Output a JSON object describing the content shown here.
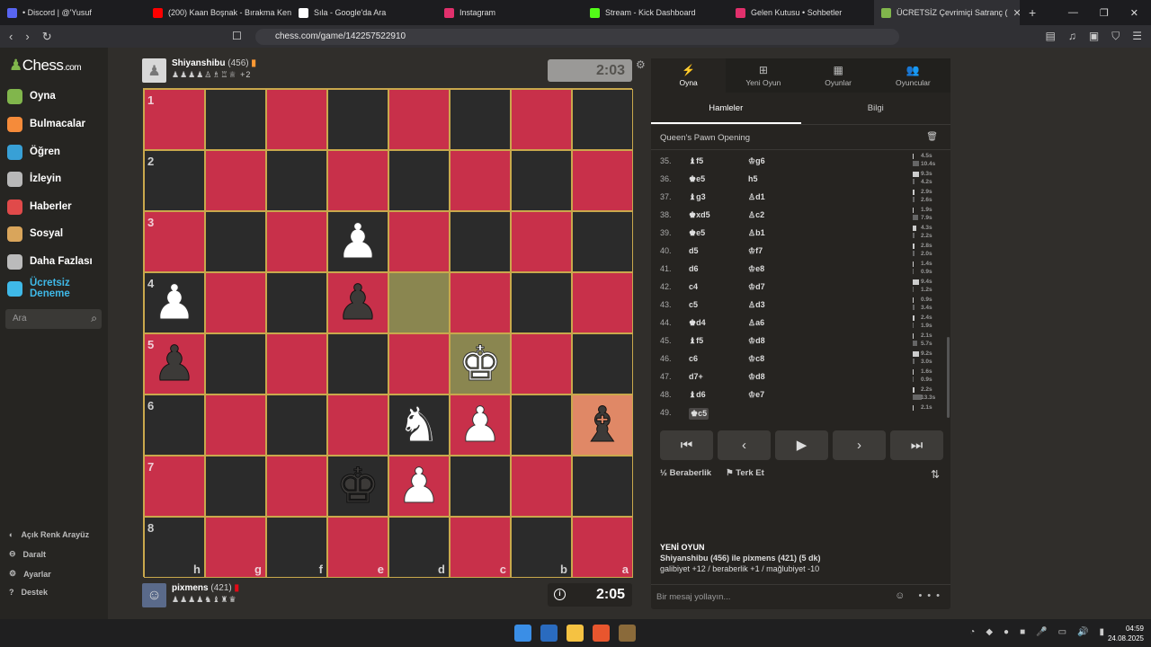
{
  "browser": {
    "tabs": [
      {
        "label": "• Discord | @'Yusuf",
        "color": "#5865f2"
      },
      {
        "label": "(200) Kaan Boşnak - Bırakma Ken",
        "color": "#ff0000"
      },
      {
        "label": "Sıla - Google'da Ara",
        "color": "#ffffff"
      },
      {
        "label": "Instagram",
        "color": "#e1306c"
      },
      {
        "label": "Stream - Kick Dashboard",
        "color": "#53fc18"
      },
      {
        "label": "Gelen Kutusu • Sohbetler",
        "color": "#e1306c"
      },
      {
        "label": "ÜCRETSİZ Çevrimiçi Satranç (",
        "color": "#81b64c"
      }
    ],
    "new_tab": "+",
    "close": "✕",
    "url": "chess.com/game/142257522910"
  },
  "sidebar": {
    "logo": "Chess",
    "logo_suffix": ".com",
    "items": [
      {
        "label": "Oyna",
        "icon": "pawn-icon",
        "color": "#81b64c"
      },
      {
        "label": "Bulmacalar",
        "icon": "puzzle-icon",
        "color": "#f58b3a"
      },
      {
        "label": "Öğren",
        "icon": "learn-icon",
        "color": "#38a0d6"
      },
      {
        "label": "İzleyin",
        "icon": "binoculars-icon",
        "color": "#b8b8b8"
      },
      {
        "label": "Haberler",
        "icon": "news-icon",
        "color": "#e04a4a"
      },
      {
        "label": "Sosyal",
        "icon": "social-icon",
        "color": "#d9a55b"
      },
      {
        "label": "Daha Fazlası",
        "icon": "more-icon",
        "color": "#bbbbbb"
      },
      {
        "label": "Ücretsiz Deneme",
        "icon": "diamond-icon",
        "color": "#3fb9e8"
      }
    ],
    "search_placeholder": "Ara",
    "bottom": [
      "Açık Renk Arayüz",
      "Daralt",
      "Ayarlar",
      "Destek"
    ]
  },
  "top_player": {
    "name": "Shiyanshibu",
    "rating": "(456)",
    "captured": "♟♟♟♟♙♗♖♕",
    "plus": "+2",
    "clock": "2:03"
  },
  "bottom_player": {
    "name": "pixmens",
    "rating": "(421)",
    "captured": "♟♟♟♟♞♝♜♛",
    "clock": "2:05"
  },
  "board": {
    "ranks": [
      "1",
      "2",
      "3",
      "4",
      "5",
      "6",
      "7",
      "8"
    ],
    "files": [
      "h",
      "g",
      "f",
      "e",
      "d",
      "c",
      "b",
      "a"
    ],
    "pieces": [
      {
        "sq": [
          2,
          3
        ],
        "glyph": "♟",
        "side": "w"
      },
      {
        "sq": [
          3,
          0
        ],
        "glyph": "♟",
        "side": "w"
      },
      {
        "sq": [
          3,
          3
        ],
        "glyph": "♟",
        "side": "b"
      },
      {
        "sq": [
          4,
          0
        ],
        "glyph": "♟",
        "side": "b"
      },
      {
        "sq": [
          4,
          5
        ],
        "glyph": "♚",
        "side": "w"
      },
      {
        "sq": [
          5,
          4
        ],
        "glyph": "♞",
        "side": "w"
      },
      {
        "sq": [
          5,
          5
        ],
        "glyph": "♟",
        "side": "w"
      },
      {
        "sq": [
          5,
          7
        ],
        "glyph": "♝",
        "side": "b"
      },
      {
        "sq": [
          6,
          3
        ],
        "glyph": "♚",
        "side": "b"
      },
      {
        "sq": [
          6,
          4
        ],
        "glyph": "♟",
        "side": "w"
      }
    ],
    "colors": {
      "light": "#c8304a",
      "dark": "#2b2b2b",
      "highlight": "#8a8650",
      "highlight_orange": "#e08866"
    }
  },
  "panel": {
    "tabs": [
      {
        "label": "Oyna",
        "icon": "⚡"
      },
      {
        "label": "Yeni Oyun",
        "icon": "⊞"
      },
      {
        "label": "Oyunlar",
        "icon": "▦"
      },
      {
        "label": "Oyuncular",
        "icon": "👥"
      }
    ],
    "subtabs": [
      "Hamleler",
      "Bilgi"
    ],
    "opening": "Queen's Pawn Opening",
    "moves": [
      {
        "n": "35.",
        "w": "♝f5",
        "b": "♔g6",
        "tw": "4.5s",
        "tb": "10.4s",
        "bw": 1,
        "bb": 6
      },
      {
        "n": "36.",
        "w": "♚e5",
        "b": "h5",
        "tw": "9.3s",
        "tb": "4.2s",
        "bw": 6,
        "bb": 2
      },
      {
        "n": "37.",
        "w": "♝g3",
        "b": "♙d1",
        "tw": "2.9s",
        "tb": "2.6s",
        "bw": 2,
        "bb": 2
      },
      {
        "n": "38.",
        "w": "♚xd5",
        "b": "♙c2",
        "tw": "1.9s",
        "tb": "7.9s",
        "bw": 1,
        "bb": 5
      },
      {
        "n": "39.",
        "w": "♚e5",
        "b": "♙b1",
        "tw": "4.3s",
        "tb": "2.2s",
        "bw": 3,
        "bb": 2
      },
      {
        "n": "40.",
        "w": "d5",
        "b": "♔f7",
        "tw": "2.8s",
        "tb": "2.0s",
        "bw": 2,
        "bb": 2
      },
      {
        "n": "41.",
        "w": "d6",
        "b": "♔e8",
        "tw": "1.4s",
        "tb": "0.9s",
        "bw": 1,
        "bb": 1
      },
      {
        "n": "42.",
        "w": "c4",
        "b": "♔d7",
        "tw": "9.4s",
        "tb": "1.2s",
        "bw": 6,
        "bb": 1
      },
      {
        "n": "43.",
        "w": "c5",
        "b": "♙d3",
        "tw": "0.9s",
        "tb": "3.4s",
        "bw": 1,
        "bb": 2
      },
      {
        "n": "44.",
        "w": "♚d4",
        "b": "♙a6",
        "tw": "2.4s",
        "tb": "1.9s",
        "bw": 2,
        "bb": 1
      },
      {
        "n": "45.",
        "w": "♝f5",
        "b": "♔d8",
        "tw": "2.1s",
        "tb": "5.7s",
        "bw": 1,
        "bb": 4
      },
      {
        "n": "46.",
        "w": "c6",
        "b": "♔c8",
        "tw": "9.2s",
        "tb": "3.0s",
        "bw": 6,
        "bb": 2
      },
      {
        "n": "47.",
        "w": "d7+",
        "b": "♔d8",
        "tw": "1.6s",
        "tb": "0.9s",
        "bw": 1,
        "bb": 1
      },
      {
        "n": "48.",
        "w": "♝d6",
        "b": "♔e7",
        "tw": "2.2s",
        "tb": "13.3s",
        "bw": 2,
        "bb": 8
      },
      {
        "n": "49.",
        "w": "♚c5",
        "b": "",
        "tw": "2.1s",
        "tb": "",
        "bw": 1,
        "bb": 0
      }
    ],
    "controls": [
      "⏮",
      "‹",
      "▶",
      "›",
      "⏭"
    ],
    "draw": "Beraberlik",
    "draw_icon": "½",
    "resign": "Terk Et",
    "resign_icon": "⚑",
    "flip_icon": "⇅",
    "newgame_title": "YENİ OYUN",
    "newgame_line1": "Shiyanshibu (456) ile pixmens (421) (5 dk)",
    "newgame_line2": "galibiyet +12 / beraberlik +1 / mağlubiyet -10",
    "chat_placeholder": "Bir mesaj yollayın...",
    "chat_icons": "☺ •••"
  },
  "taskbar": {
    "time": "04:59",
    "date": "24.08.2025"
  }
}
